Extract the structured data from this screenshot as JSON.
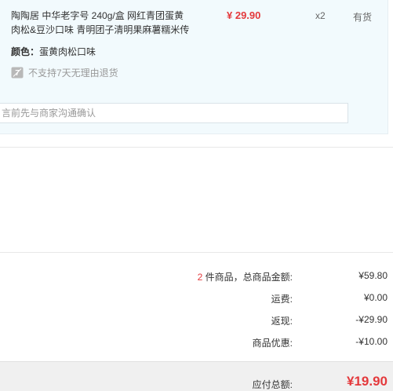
{
  "item": {
    "title_line1": "陶陶居 中华老字号 240g/盒 网红青团蛋黄",
    "title_line2": "肉松&豆沙口味 青明团子清明果麻薯糯米传",
    "price": "¥ 29.90",
    "quantity": "x2",
    "stock_status": "有货",
    "attr_label": "颜色：",
    "attr_value": "蛋黄肉松口味",
    "no_return_icon": "seven-day-badge-icon",
    "no_return_icon_text": "7",
    "no_return_text": "不支持7天无理由退货",
    "remark_placeholder": "言前先与商家沟通确认"
  },
  "summary": {
    "goods_count": "2",
    "goods_label": " 件商品，总商品金额:",
    "goods_total": "¥59.80",
    "shipping_label": "运费:",
    "shipping_value": "¥0.00",
    "cashback_label": "返现:",
    "cashback_value": "-¥29.90",
    "discount_label": "商品优惠:",
    "discount_value": "-¥10.00"
  },
  "total": {
    "label": "应付总额:",
    "value": "¥19.90"
  },
  "colors": {
    "price_red": "#e4393c",
    "card_bg": "#f2fafd",
    "total_bar_bg": "#f0f0f0"
  }
}
